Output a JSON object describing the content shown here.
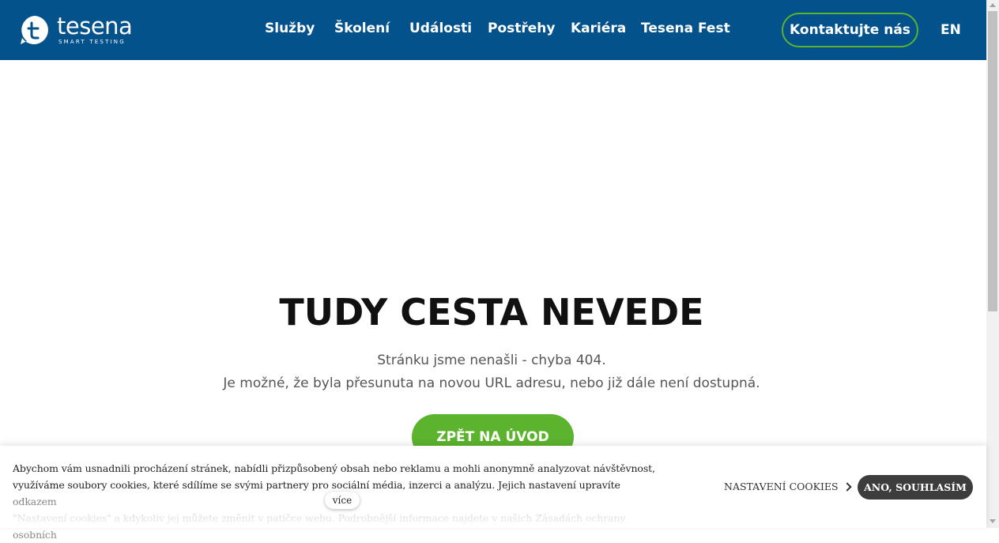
{
  "header": {
    "logo_name": "tesena",
    "logo_tagline": "SMART TESTING",
    "nav": [
      {
        "label": "Služby"
      },
      {
        "label": "Školení"
      },
      {
        "label": "Události"
      },
      {
        "label": "Postřehy"
      },
      {
        "label": "Kariéra"
      },
      {
        "label": "Tesena Fest"
      }
    ],
    "contact_label": "Kontaktujte nás",
    "lang_label": "EN"
  },
  "main": {
    "title": "TUDY CESTA NEVEDE",
    "subtitle_line1": "Stránku jsme nenašli - chyba 404.",
    "subtitle_line2": "Je možné, že byla přesunuta na novou URL adresu, nebo již dále není dostupná.",
    "home_button": "ZPĚT NA ÚVOD"
  },
  "cookie": {
    "line1": "Abychom vám usnadnili procházení stránek, nabídli přizpůsobený obsah nebo reklamu a mohli anonymně analyzovat návštěvnost,",
    "line2": "využíváme soubory cookies, které sdílíme se svými partnery pro sociální média, inzerci a analýzu. Jejich nastavení upravíte odkazem",
    "line3": "\"Nastavení cookies\" a kdykoliv jej můžete změnit v patičce webu. Podrobnější informace najdete v našich Zásadách ochrany osobních",
    "more_label": "více",
    "settings_label": "NASTAVENÍ COOKIES",
    "agree_label": "ANO, SOUHLASÍM"
  },
  "colors": {
    "header_bg": "#03528c",
    "accent_green": "#5cb32e",
    "agree_bg": "#3d3d3d"
  }
}
